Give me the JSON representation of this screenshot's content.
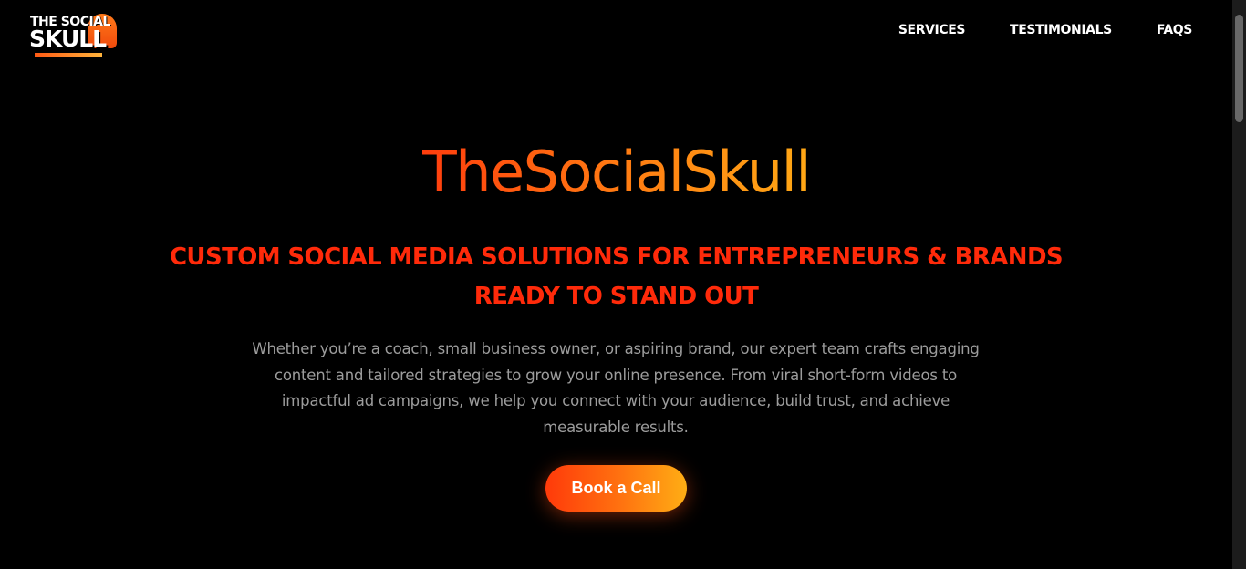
{
  "brand": {
    "logo_top": "THE SOCIAL",
    "logo_bottom": "SKULL",
    "accent_start": "#ff3d0d",
    "accent_end": "#ffa815"
  },
  "nav": {
    "items": [
      {
        "label": "SERVICES"
      },
      {
        "label": "TESTIMONIALS"
      },
      {
        "label": "FAQS"
      }
    ]
  },
  "hero": {
    "title": "TheSocialSkull",
    "subtitle_line1": "CUSTOM SOCIAL MEDIA SOLUTIONS FOR ENTREPRENEURS & BRANDS",
    "subtitle_line2": "READY TO STAND OUT",
    "description": "Whether you’re a coach, small business owner, or aspiring brand, our expert team crafts engaging content and tailored strategies to grow your online presence. From viral short-form videos to impactful ad campaigns, we help you connect with your audience, build trust, and achieve measurable results.",
    "cta_label": "Book a Call"
  }
}
